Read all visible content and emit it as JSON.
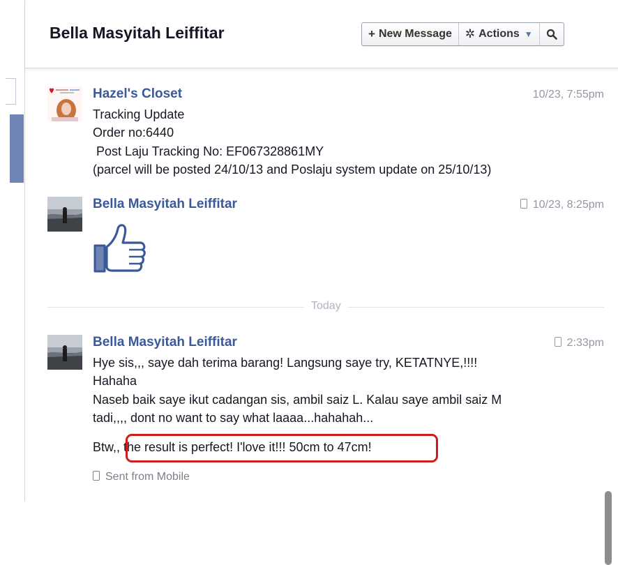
{
  "header": {
    "title": "Bella Masyitah Leiffitar",
    "toolbar": {
      "new_message": "New Message",
      "actions": "Actions"
    }
  },
  "messages": [
    {
      "sender": "Hazel's Closet",
      "time": "10/23, 7:55pm",
      "lines": [
        "Tracking Update",
        "Order no:6440",
        " Post Laju Tracking No: EF067328861MY",
        "(parcel will be posted 24/10/13 and Poslaju system update on 25/10/13)"
      ]
    },
    {
      "sender": "Bella Masyitah Leiffitar",
      "time": "10/23, 8:25pm",
      "content": "thumbs-up sticker"
    },
    {
      "sender": "Bella Masyitah Leiffitar",
      "time": "2:33pm",
      "lines": [
        "Hye sis,,, saye dah terima barang! Langsung saye try, KETATNYE,!!!!",
        "Hahaha",
        "Naseb baik saye ikut cadangan sis, ambil saiz L. Kalau saye ambil saiz M",
        "tadi,,,, dont no want to say what laaaa...hahahah...",
        "Btw,, the result is perfect! I'love it!!! 50cm to 47cm!"
      ],
      "footer": "Sent from Mobile"
    }
  ],
  "divider_label": "Today",
  "colors": {
    "link": "#3b5998",
    "highlight": "#d11a1a",
    "timestamp": "#9197a3"
  },
  "icons": {
    "new_message": "plus-icon",
    "actions": "gear-icon",
    "search": "search-icon",
    "mobile": "mobile-phone-icon"
  }
}
